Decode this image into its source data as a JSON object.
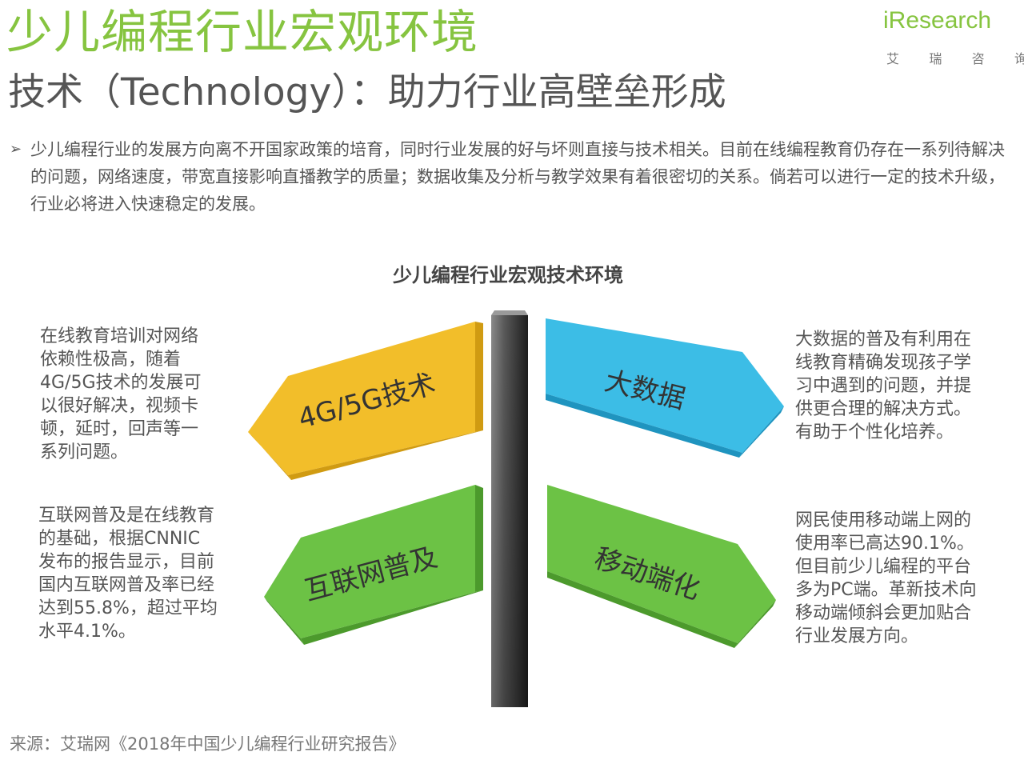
{
  "header": {
    "title": "少儿编程行业宏观环境",
    "subtitle": "技术（Technology）：助力行业高壁垒形成"
  },
  "logo": {
    "wordmark": "iResearch",
    "chars": [
      "艾",
      "瑞",
      "咨",
      "询"
    ]
  },
  "intro": {
    "bullet_glyph": "➢",
    "text": "少儿编程行业的发展方向离不开国家政策的培育，同时行业发展的好与坏则直接与技术相关。目前在线编程教育仍存在一系列待解决的问题，网络速度，带宽直接影响直播教学的质量；数据收集及分析与教学效果有着很密切的关系。倘若可以进行一定的技术升级，行业必将进入快速稳定的发展。"
  },
  "diagram": {
    "title": "少儿编程行业宏观技术环境",
    "signs": [
      {
        "label": "4G/5G技术",
        "color": "#f2be2a"
      },
      {
        "label": "大数据",
        "color": "#3cbde6"
      },
      {
        "label": "互联网普及",
        "color": "#6cc245"
      },
      {
        "label": "移动端化",
        "color": "#6cc245"
      }
    ],
    "descriptions": {
      "top_left": "在线教育培训对网络依赖性极高，随着4G/5G技术的发展可以很好解决，视频卡顿，延时，回声等一系列问题。",
      "top_right": "大数据的普及有利用在线教育精确发现孩子学习中遇到的问题，并提供更合理的解决方式。有助于个性化培养。",
      "bottom_left": "互联网普及是在线教育的基础，根据CNNIC发布的报告显示，目前国内互联网普及率已经达到55.8%，超过平均水平4.1%。",
      "bottom_right": "网民使用移动端上网的使用率已高达90.1%。但目前少儿编程的平台多为PC端。革新技术向移动端倾斜会更加贴合行业发展方向。"
    }
  },
  "footer": {
    "source": "来源：艾瑞网《2018年中国少儿编程行业研究报告》"
  },
  "colors": {
    "brand_green": "#86c440",
    "pole_dark": "#333333"
  }
}
